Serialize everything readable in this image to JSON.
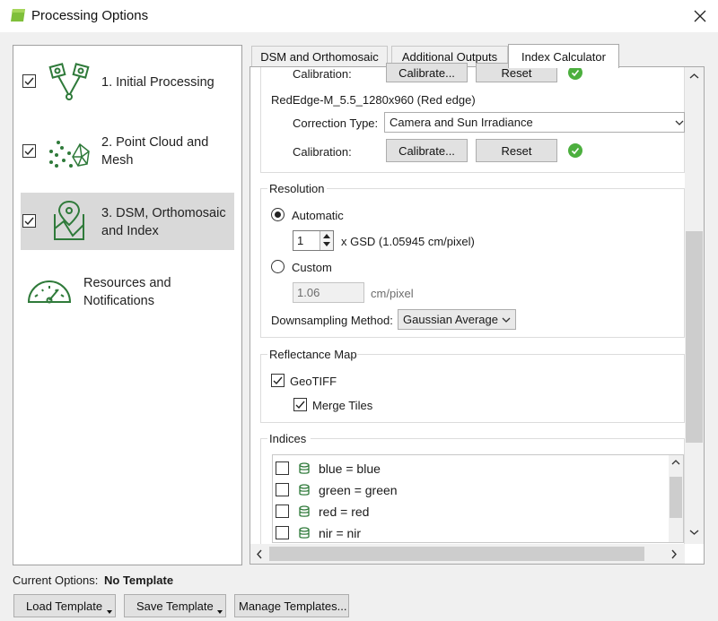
{
  "window": {
    "title": "Processing Options"
  },
  "nav": {
    "items": [
      {
        "label_line1": "1. Initial Processing",
        "label_line2": "",
        "checked": true
      },
      {
        "label_line1": "2. Point Cloud and",
        "label_line2": "Mesh",
        "checked": true
      },
      {
        "label_line1": "3. DSM, Orthomosaic",
        "label_line2": "and Index",
        "checked": true
      },
      {
        "label_line1": "Resources and",
        "label_line2": "Notifications"
      }
    ]
  },
  "tabs": [
    "DSM and Orthomosaic",
    "Additional Outputs",
    "Index Calculator"
  ],
  "radiometric": {
    "top_calibration_label": "Calibration:",
    "calibrate_label": "Calibrate...",
    "reset_label": "Reset",
    "band_name": "RedEdge-M_5.5_1280x960 (Red edge)",
    "correction_label": "Correction Type:",
    "correction_value": "Camera and Sun Irradiance",
    "calibration_label": "Calibration:"
  },
  "resolution": {
    "group_title": "Resolution",
    "automatic_label": "Automatic",
    "gsd_multiplier": "1",
    "gsd_text": "x GSD (1.05945 cm/pixel)",
    "custom_label": "Custom",
    "custom_value": "1.06",
    "custom_unit": "cm/pixel",
    "downsampling_label": "Downsampling Method:",
    "downsampling_value": "Gaussian Average"
  },
  "reflectance": {
    "group_title": "Reflectance Map",
    "geotiff_label": "GeoTIFF",
    "merge_label": "Merge Tiles"
  },
  "indices": {
    "group_title": "Indices",
    "items": [
      "blue = blue",
      "green = green",
      "red = red",
      "nir = nir"
    ]
  },
  "footer": {
    "current_options_label": "Current Options:",
    "current_options_value": "No Template",
    "load_label": "Load Template",
    "save_label": "Save Template",
    "manage_label": "Manage Templates..."
  },
  "colors": {
    "accent_green": "#2f7a3a",
    "ok_green": "#4caf3e"
  }
}
